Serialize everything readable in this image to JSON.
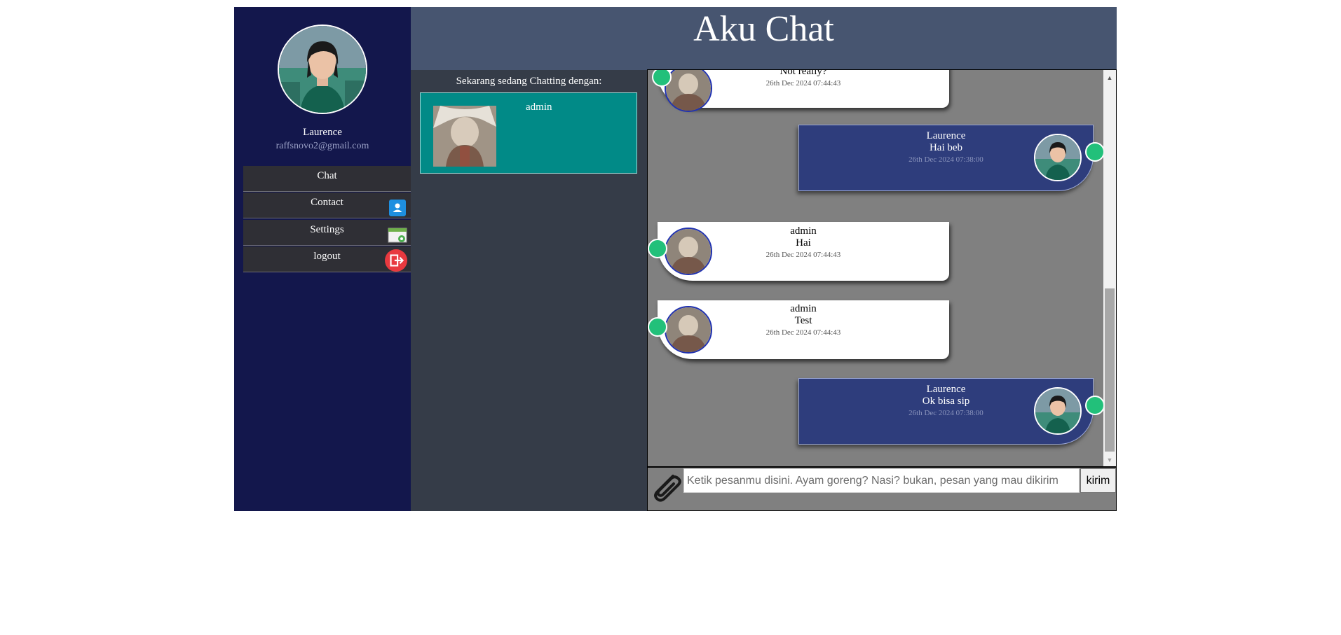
{
  "header": {
    "title": "Aku Chat"
  },
  "profile": {
    "name": "Laurence",
    "email": "raffsnovo2@gmail.com"
  },
  "menu": [
    {
      "label": "Chat",
      "icon": ""
    },
    {
      "label": "Contact",
      "icon": "contact-icon"
    },
    {
      "label": "Settings",
      "icon": "settings-icon"
    },
    {
      "label": "logout",
      "icon": "logout-icon"
    }
  ],
  "contacts": {
    "heading": "Sekarang sedang Chatting dengan:",
    "active": {
      "name": "admin"
    }
  },
  "messages": [
    {
      "direction": "in",
      "name": "",
      "text": "Not really?",
      "time": "26th Dec 2024 07:44:43"
    },
    {
      "direction": "out",
      "name": "Laurence",
      "text": "Hai beb",
      "time": "26th Dec 2024 07:38:00"
    },
    {
      "direction": "in",
      "name": "admin",
      "text": "Hai",
      "time": "26th Dec 2024 07:44:43"
    },
    {
      "direction": "in",
      "name": "admin",
      "text": "Test",
      "time": "26th Dec 2024 07:44:43"
    },
    {
      "direction": "out",
      "name": "Laurence",
      "text": "Ok bisa sip",
      "time": "26th Dec 2024 07:38:00"
    }
  ],
  "composer": {
    "placeholder": "Ketik pesanmu disini. Ayam goreng? Nasi? bukan, pesan yang mau dikirim",
    "value": "",
    "send_label": "kirim"
  },
  "colors": {
    "sidebar": "#13174c",
    "header": "#475570",
    "contacts_panel": "#353c48",
    "contact_card": "#018a87",
    "chat_bg": "#808080",
    "outgoing_bubble": "#2e3d7c",
    "online_status": "#22c07a",
    "logout": "#e8393f",
    "contact_icon": "#1e8fe0"
  }
}
